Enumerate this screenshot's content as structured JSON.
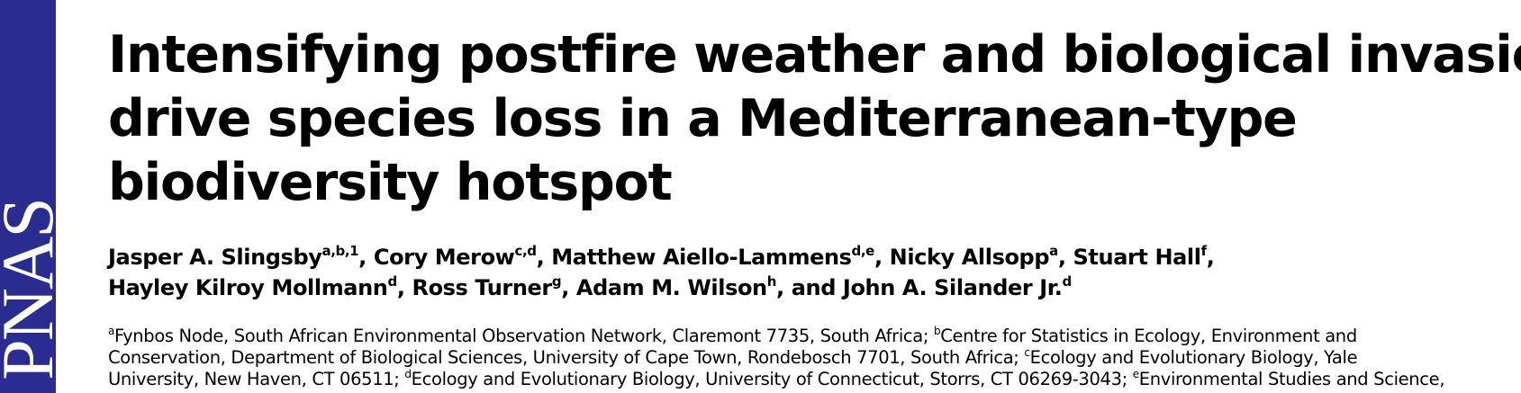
{
  "journal": {
    "logo_text": "PNAS",
    "brand_color": "#2b2c8f"
  },
  "title": {
    "lines": [
      "Intensifying postfire weather and biological invasion",
      "drive species loss in a Mediterranean-type",
      "biodiversity hotspot"
    ]
  },
  "authors": {
    "line1": [
      {
        "name": "Jasper A. Slingsby",
        "sup": "a,b,1",
        "sep": ", "
      },
      {
        "name": "Cory Merow",
        "sup": "c,d",
        "sep": ", "
      },
      {
        "name": "Matthew Aiello-Lammens",
        "sup": "d,e",
        "sep": ", "
      },
      {
        "name": "Nicky Allsopp",
        "sup": "a",
        "sep": ", "
      },
      {
        "name": "Stuart Hall",
        "sup": "f",
        "sep": ","
      }
    ],
    "line2": [
      {
        "name": "Hayley Kilroy Mollmann",
        "sup": "d",
        "sep": ", "
      },
      {
        "name": "Ross Turner",
        "sup": "g",
        "sep": ", "
      },
      {
        "name": "Adam M. Wilson",
        "sup": "h",
        "sep": ", "
      },
      {
        "name": "and John A. Silander Jr.",
        "sup": "d",
        "sep": ""
      }
    ]
  },
  "affiliations": {
    "line1": [
      {
        "sup": "a",
        "text": "Fynbos Node, South African Environmental Observation Network, Claremont 7735, South Africa; "
      },
      {
        "sup": "b",
        "text": "Centre for Statistics in Ecology, Environment and"
      }
    ],
    "line2": [
      {
        "sup": "",
        "text": "Conservation, Department of Biological Sciences, University of Cape Town, Rondebosch 7701, South Africa; "
      },
      {
        "sup": "c",
        "text": "Ecology and Evolutionary Biology, Yale"
      }
    ],
    "line3": [
      {
        "sup": "",
        "text": "University, New Haven, CT 06511; "
      },
      {
        "sup": "d",
        "text": "Ecology and Evolutionary Biology, University of Connecticut, Storrs, CT 06269-3043; "
      },
      {
        "sup": "e",
        "text": "Environmental Studies and Science,"
      }
    ]
  }
}
